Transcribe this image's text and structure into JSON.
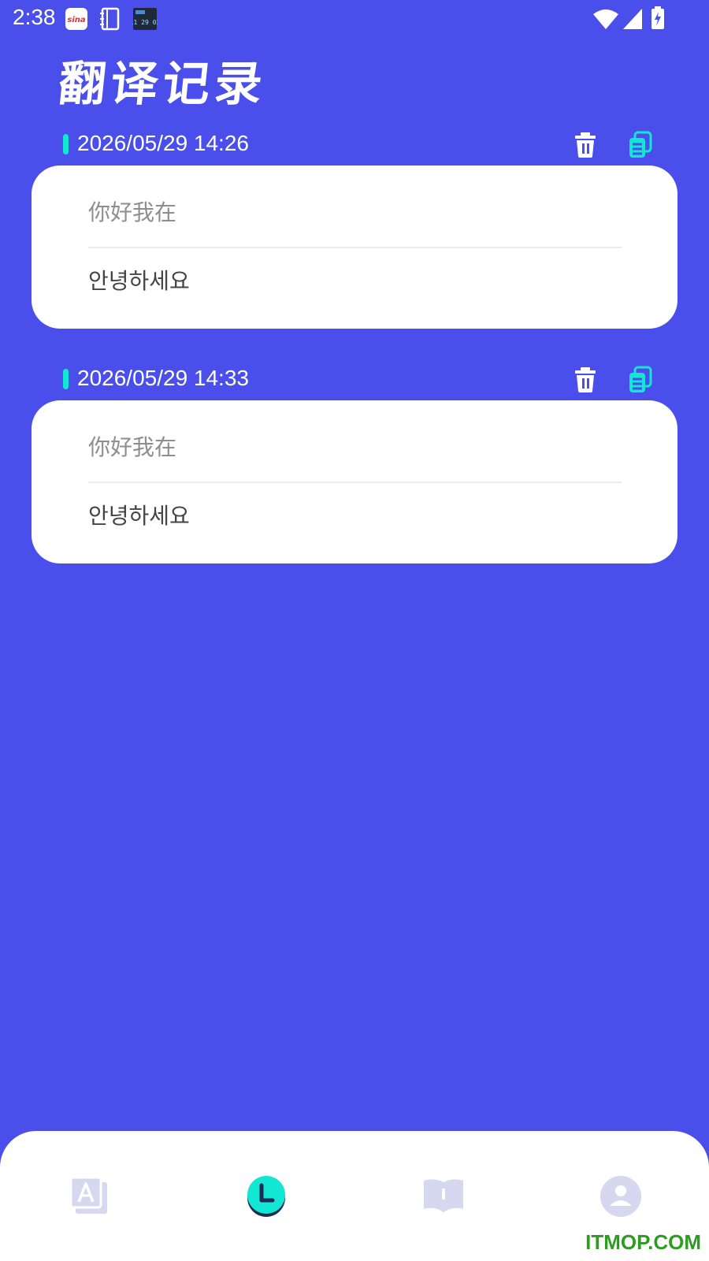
{
  "status_bar": {
    "time": "2:38",
    "notification_icons": [
      "sina-icon",
      "notebook-icon",
      "clock-widget-icon"
    ],
    "system_icons": [
      "wifi-icon",
      "signal-icon",
      "battery-charging-icon"
    ]
  },
  "page": {
    "title": "翻译记录"
  },
  "records": [
    {
      "timestamp": "2026/05/29 14:26",
      "source_text": "你好我在",
      "translated_text": "안녕하세요"
    },
    {
      "timestamp": "2026/05/29 14:33",
      "source_text": "你好我在",
      "translated_text": "안녕하세요"
    }
  ],
  "bottom_nav": {
    "items": [
      {
        "icon": "translate-icon",
        "active": false
      },
      {
        "icon": "history-clock-icon",
        "active": true
      },
      {
        "icon": "book-icon",
        "active": false
      },
      {
        "icon": "profile-icon",
        "active": false
      }
    ]
  },
  "watermark": "ITMOP.COM",
  "colors": {
    "background": "#4a4fec",
    "accent": "#13e6d3",
    "card": "#ffffff",
    "inactive_icon": "#d5d8ee",
    "watermark": "#2e9c23"
  }
}
